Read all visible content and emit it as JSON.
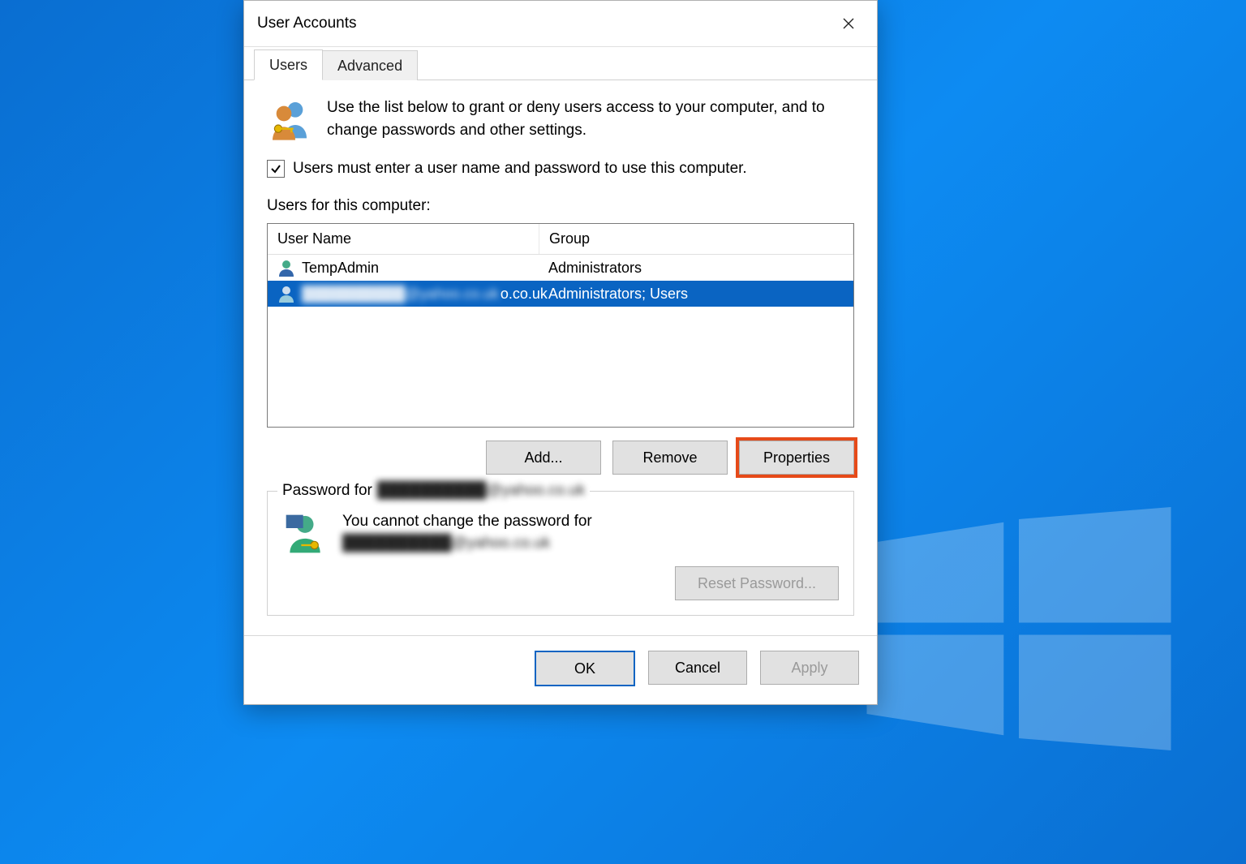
{
  "window": {
    "title": "User Accounts"
  },
  "tabs": {
    "users": "Users",
    "advanced": "Advanced"
  },
  "intro": "Use the list below to grant or deny users access to your computer, and to change passwords and other settings.",
  "checkbox": {
    "label": "Users must enter a user name and password to use this computer.",
    "checked": true
  },
  "list": {
    "caption": "Users for this computer:",
    "headers": {
      "user": "User Name",
      "group": "Group"
    },
    "rows": [
      {
        "name": "TempAdmin",
        "group": "Administrators",
        "selected": false,
        "blurred": false
      },
      {
        "name": "██████████@yahoo.co.uk",
        "group": "Administrators; Users",
        "selected": true,
        "blurred": true,
        "visible_suffix": "o.co.uk"
      }
    ]
  },
  "buttons": {
    "add": "Add...",
    "remove": "Remove",
    "properties": "Properties",
    "reset_pw": "Reset Password...",
    "ok": "OK",
    "cancel": "Cancel",
    "apply": "Apply"
  },
  "password_group": {
    "prefix": "Password for",
    "user_redacted": "██████████@yahoo.co.uk",
    "line1": "You cannot change the password for",
    "line2_redacted": "██████████@yahoo.co.uk"
  },
  "highlight": "properties"
}
